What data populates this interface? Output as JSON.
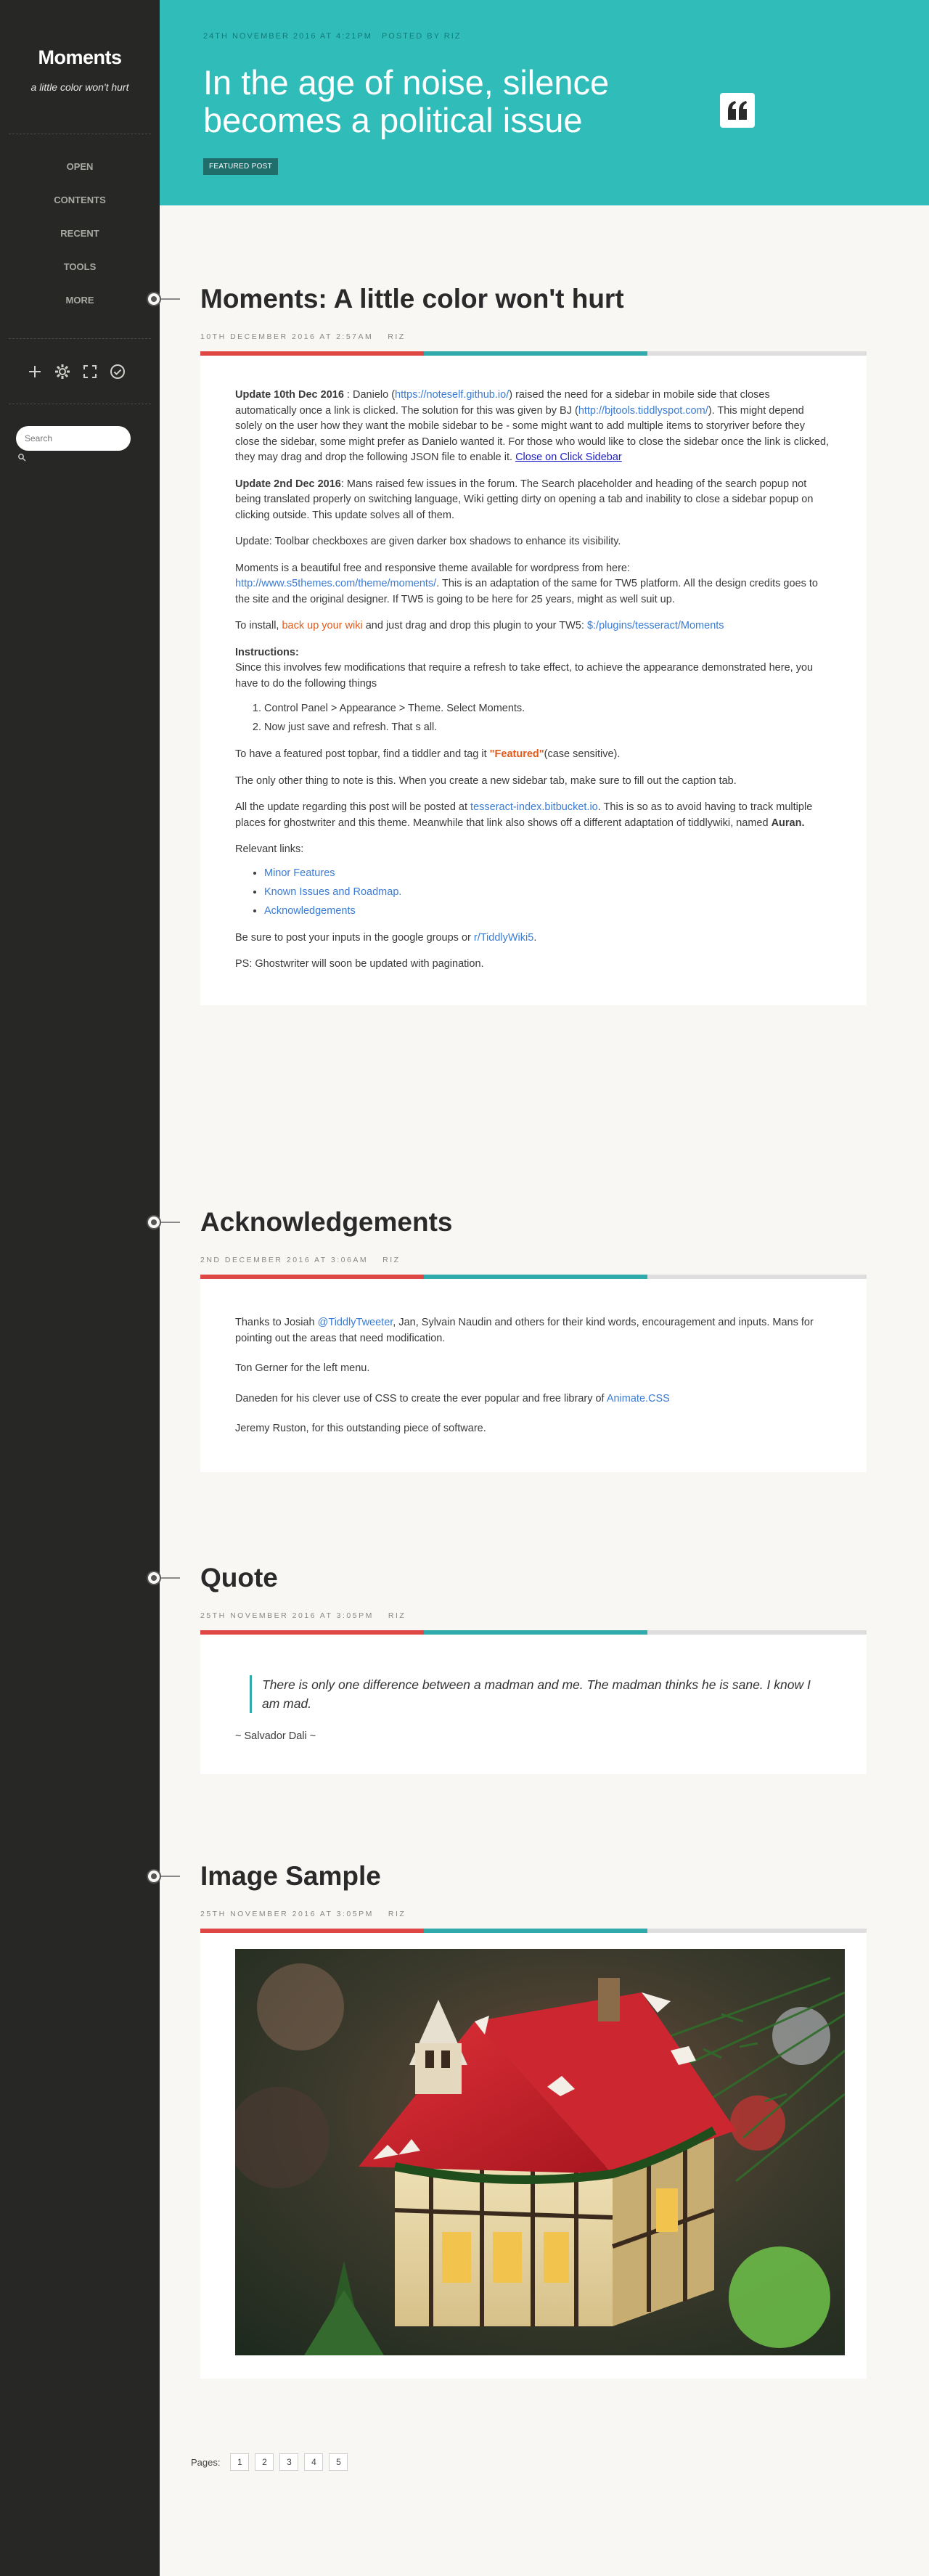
{
  "sidebar": {
    "title": "Moments",
    "subtitle": "a little color won't hurt",
    "nav": [
      "OPEN",
      "CONTENTS",
      "RECENT",
      "TOOLS",
      "MORE"
    ],
    "tools": [
      "plus-icon",
      "gear-icon",
      "fullscreen-icon",
      "check-circle-icon"
    ],
    "search_placeholder": "Search"
  },
  "hero": {
    "date": "24TH NOVEMBER 2016 AT 4:21PM",
    "posted_by": "POSTED BY RIZ",
    "title": "In the age of noise, silence becomes a political issue",
    "badge": "FEATURED POST",
    "colors": {
      "background": "#30bdba",
      "badge": "#1f6e6c"
    }
  },
  "colors": {
    "red": "#de4744",
    "teal": "#30aaaa",
    "grey": "#dedede",
    "link": "#3a7bd5",
    "orange": "#e05a1c"
  },
  "posts": {
    "p1": {
      "title": "Moments: A little color won't hurt",
      "date": "10TH DECEMBER 2016 AT 2:57AM",
      "author": "RIZ",
      "u1_head": "Update 10th Dec 2016",
      "u1_a": " : Danielo (",
      "u1_link1": "https://noteself.github.io/",
      "u1_b": ") raised the need for a sidebar in mobile side that closes automatically once a link is clicked. The solution for this was given by BJ (",
      "u1_link2": "http://bjtools.tiddlyspot.com/",
      "u1_c": "). This might depend solely on the user how they want the mobile sidebar to be - some might want to add multiple items to storyriver before they close the sidebar, some might prefer as Danielo wanted it. For those who would like to close the sidebar once the link is clicked, they may drag and drop the following JSON file to enable it. ",
      "u1_link3": "Close on Click Sidebar",
      "u2_head": "Update 2nd Dec 2016",
      "u2_text": ": Mans raised few issues in the forum. The Search placeholder and heading of the search popup not being translated properly on switching language, Wiki getting dirty on opening a tab and inability to close a sidebar popup on clicking outside. This update solves all of them.",
      "u3": "Update: Toolbar checkboxes are given darker box shadows to enhance its visibility.",
      "p4_a": "Moments is a beautiful free and responsive theme available for wordpress from here:",
      "p4_link": "http://www.s5themes.com/theme/moments/",
      "p4_b": ". This is an adaptation of the same for TW5 platform. All the design credits goes to the site and the original designer. If TW5 is going to be here for 25 years, might as well suit up.",
      "p5_a": "To install, ",
      "p5_link1": "back up your wiki",
      "p5_b": " and just drag and drop this plugin to your TW5: ",
      "p5_link2": "$:/plugins/tesseract/Moments",
      "instr_head": "Instructions:",
      "instr_text": "Since this involves few modifications that require a refresh to take effect, to achieve the appearance demonstrated here, you have to do the following things",
      "steps": [
        "Control Panel > Appearance > Theme. Select Moments.",
        "Now just save and refresh. That s all."
      ],
      "p7_a": "To have a featured post topbar, find a tiddler and tag it ",
      "p7_tag": "\"Featured\"",
      "p7_b": "(case sensitive).",
      "p8": "The only other thing to note is this. When you create a new sidebar tab, make sure to fill out the caption tab.",
      "p9_a": "All the update regarding this post will be posted at ",
      "p9_link": "tesseract-index.bitbucket.io",
      "p9_b": ". This is so as to avoid having to track multiple places for ghostwriter and this theme. Meanwhile that link also shows off a different adaptation of tiddlywiki, named ",
      "p9_bold": "Auran.",
      "rel_head": "Relevant links:",
      "rel_links": [
        "Minor Features",
        "Known Issues and Roadmap.",
        "Acknowledgements"
      ],
      "p11_a": "Be sure to post your inputs in the google groups or ",
      "p11_link": "r/TiddlyWiki5",
      "p11_b": ".",
      "p12": "PS: Ghostwriter will soon be updated with pagination."
    },
    "p2": {
      "title": "Acknowledgements",
      "date": "2ND DECEMBER 2016 AT 3:06AM",
      "author": "RIZ",
      "a1_a": "Thanks to Josiah ",
      "a1_link": "@TiddlyTweeter",
      "a1_b": ", Jan, Sylvain Naudin and others for their kind words, encouragement and inputs. Mans for pointing out the areas that need modification.",
      "a2": "Ton Gerner for the left menu.",
      "a3_a": "Daneden for his clever use of CSS to create the ever popular and free library of ",
      "a3_link": "Animate.CSS",
      "a4": "Jeremy Ruston, for this outstanding piece of software."
    },
    "p3": {
      "title": "Quote",
      "date": "25TH NOVEMBER 2016 AT 3:05PM",
      "author": "RIZ",
      "quote": "There is only one difference between a madman and me. The madman thinks he is sane. I know I am mad.",
      "attribution": "~ Salvador Dali ~"
    },
    "p4": {
      "title": "Image Sample",
      "date": "25TH NOVEMBER 2016 AT 3:05PM",
      "author": "RIZ"
    }
  },
  "pager": {
    "label": "Pages:",
    "pages": [
      "1",
      "2",
      "3",
      "4",
      "5"
    ]
  }
}
